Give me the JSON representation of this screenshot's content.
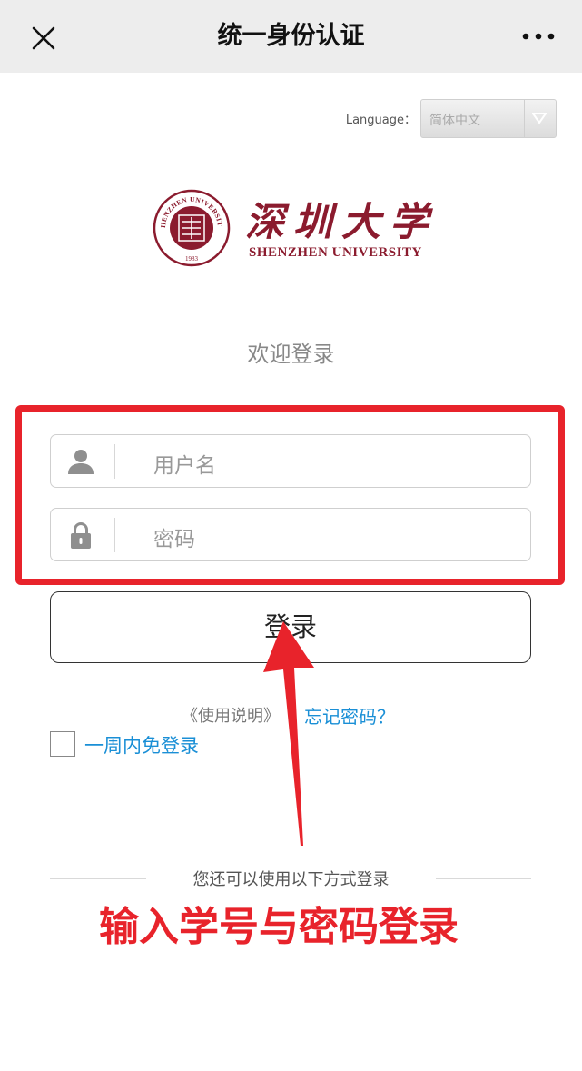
{
  "topbar": {
    "title": "统一身份认证",
    "close_icon": "close-icon",
    "more_icon": "more-dots-icon"
  },
  "language": {
    "label": "Language：",
    "selected": "简体中文"
  },
  "logo": {
    "name_cn": "深圳大学",
    "name_en": "SHENZHEN UNIVERSITY",
    "seal_text": "SHENZHEN UNIVERSITY",
    "seal_year": "1983",
    "brand_color": "#8b1b2e"
  },
  "welcome": "欢迎登录",
  "form": {
    "username_placeholder": "用户名",
    "password_placeholder": "密码",
    "login_button": "登录"
  },
  "links": {
    "usage": "《使用说明》",
    "forgot": "忘记密码？",
    "remember": "一周内免登录"
  },
  "alt_login": "您还可以使用以下方式登录",
  "annotation": {
    "text": "输入学号与密码登录",
    "color": "#e8232b"
  }
}
